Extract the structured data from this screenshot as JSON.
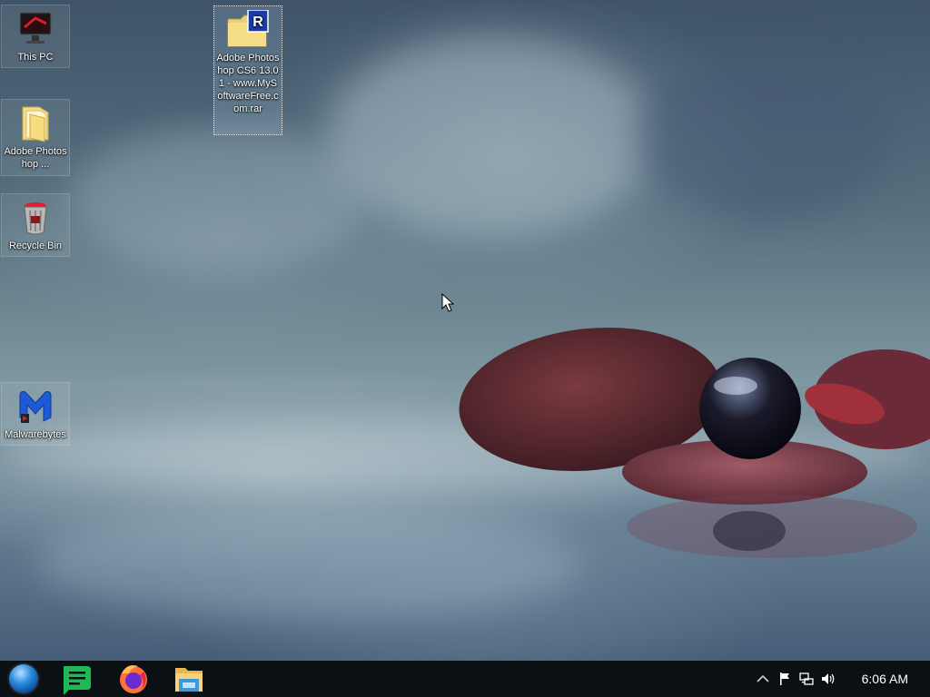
{
  "desktop_icons": [
    {
      "label": "This PC",
      "icon": "computer-icon"
    },
    {
      "label": "Adobe Photoshop ...",
      "icon": "folder-icon"
    },
    {
      "label": "Recycle Bin",
      "icon": "recycle-bin-icon"
    },
    {
      "label": "Malwarebytes",
      "icon": "malwarebytes-icon"
    },
    {
      "label": "Adobe Photoshop CS6 13.01 - www.MySoftwareFree.com.rar",
      "icon": "winrar-archive-icon"
    }
  ],
  "taskbar": {
    "pinned": [
      "start-orb-icon",
      "notes-app-icon",
      "firefox-icon",
      "file-explorer-icon"
    ],
    "tray_icons": [
      "show-hidden-icons-chevron",
      "action-center-flag-icon",
      "network-icon",
      "volume-icon"
    ],
    "time": "6:06 AM"
  },
  "colors": {
    "taskbar_bg": "#0b1014",
    "notes_green": "#1db954",
    "firefox_orange": "#ff7139",
    "malwarebytes_blue": "#1e5ad6"
  }
}
